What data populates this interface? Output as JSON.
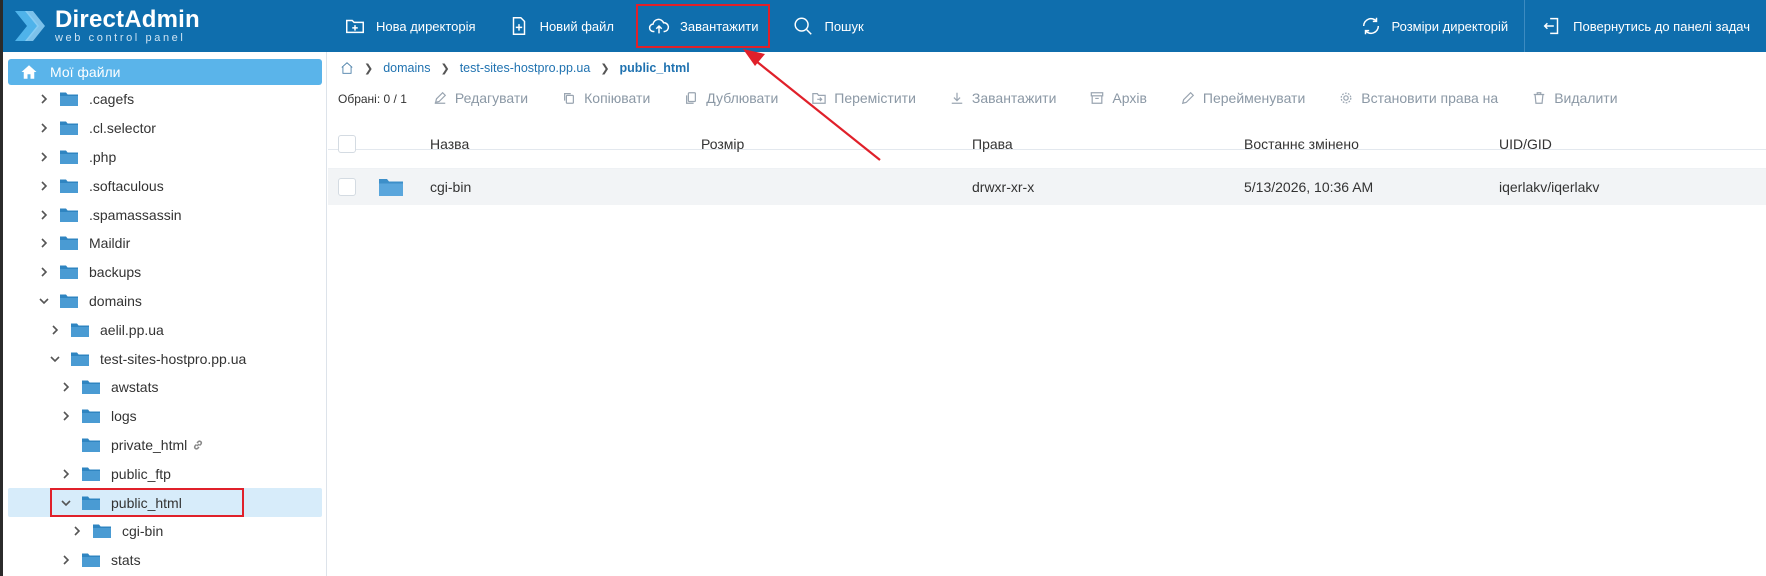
{
  "brand": {
    "title": "DirectAdmin",
    "subtitle": "web control panel"
  },
  "toolbar": {
    "new_dir": "Нова директорія",
    "new_file": "Новий файл",
    "upload": "Завантажити",
    "search": "Пошук",
    "dir_sizes": "Розміри директорій",
    "back": "Повернутись до панелі задач"
  },
  "sidebar": {
    "root": "Мої файли",
    "items": [
      {
        "label": ".cagefs"
      },
      {
        "label": ".cl.selector"
      },
      {
        "label": ".php"
      },
      {
        "label": ".softaculous"
      },
      {
        "label": ".spamassassin"
      },
      {
        "label": "Maildir"
      },
      {
        "label": "backups"
      },
      {
        "label": "domains"
      },
      {
        "label": "aelil.pp.ua"
      },
      {
        "label": "test-sites-hostpro.pp.ua"
      },
      {
        "label": "awstats"
      },
      {
        "label": "logs"
      },
      {
        "label": "private_html"
      },
      {
        "label": "public_ftp"
      },
      {
        "label": "public_html"
      },
      {
        "label": "cgi-bin"
      },
      {
        "label": "stats"
      }
    ]
  },
  "breadcrumb": {
    "items": [
      "domains",
      "test-sites-hostpro.pp.ua"
    ],
    "current": "public_html"
  },
  "actions": {
    "selected": "Обрані: 0 / 1",
    "edit": "Редагувати",
    "copy": "Копіювати",
    "duplicate": "Дублювати",
    "move": "Перемістити",
    "download": "Завантажити",
    "archive": "Архів",
    "rename": "Перейменувати",
    "perms": "Встановити права на",
    "delete": "Видалити"
  },
  "table": {
    "headers": {
      "name": "Назва",
      "size": "Розмір",
      "perms": "Права",
      "modified": "Востаннє змінено",
      "uid": "UID/GID"
    },
    "rows": [
      {
        "name": "cgi-bin",
        "size": "",
        "perms": "drwxr-xr-x",
        "modified": "5/13/2026, 10:36 AM",
        "uid": "iqerlakv/iqerlakv"
      }
    ]
  },
  "colors": {
    "topbar": "#0f6ead",
    "accent": "#5ab4ea",
    "highlight": "#e0202a"
  }
}
